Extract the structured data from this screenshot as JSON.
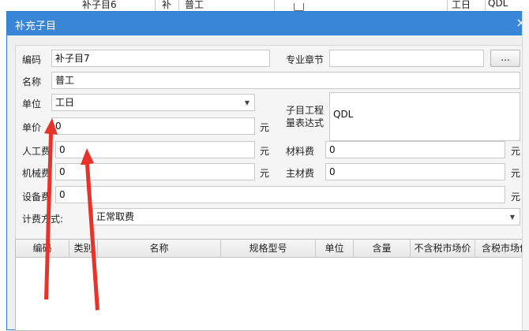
{
  "background_row": {
    "name": "补子目6",
    "type": "补",
    "desc": "普工",
    "unit": "工日",
    "code": "QDL"
  },
  "dialog": {
    "title": "补充子目",
    "close_glyph": "×"
  },
  "form": {
    "code_label": "编码",
    "code_value": "补子目7",
    "chapter_label": "专业章节",
    "chapter_value": "",
    "chapter_button": "...",
    "name_label": "名称",
    "name_value": "普工",
    "unit_label": "单位",
    "unit_value": "工日",
    "expr_label_line1": "子目工程",
    "expr_label_line2": "量表达式",
    "expr_value": "QDL",
    "price_label": "单价",
    "price_value": "0",
    "labor_label": "人工费",
    "labor_value": "0",
    "material_label": "材料费",
    "material_value": "0",
    "machine_label": "机械费",
    "machine_value": "0",
    "main_material_label": "主材费",
    "main_material_value": "0",
    "equipment_label": "设备费",
    "equipment_value": "0",
    "billing_label": "计费方式:",
    "billing_value": "正常取费",
    "currency_unit": "元"
  },
  "table": {
    "columns": [
      "编码",
      "类别",
      "名称",
      "规格型号",
      "单位",
      "含量",
      "不含税市场价",
      "含税市场价"
    ]
  },
  "colors": {
    "titlebar": "#3a86d6",
    "arrow": "#e8332a"
  }
}
